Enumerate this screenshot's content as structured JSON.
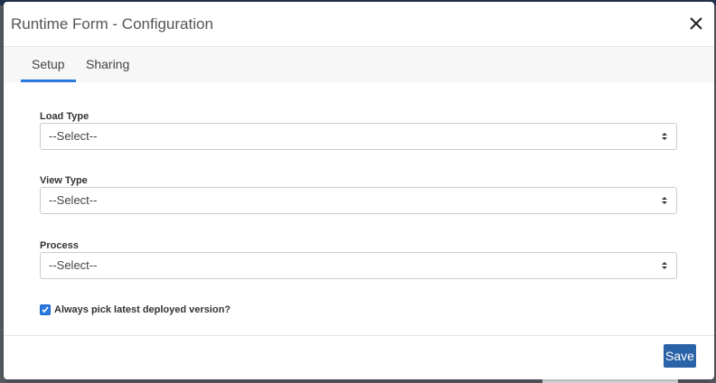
{
  "dialog": {
    "title": "Runtime Form - Configuration"
  },
  "tabs": [
    {
      "label": "Setup",
      "active": true
    },
    {
      "label": "Sharing",
      "active": false
    }
  ],
  "form": {
    "load_type": {
      "label": "Load Type",
      "value": "--Select--"
    },
    "view_type": {
      "label": "View Type",
      "value": "--Select--"
    },
    "process": {
      "label": "Process",
      "value": "--Select--"
    },
    "latest_version": {
      "label": "Always pick latest deployed version?",
      "checked": true
    }
  },
  "footer": {
    "save_label": "Save"
  },
  "colors": {
    "accent": "#2a7ae2",
    "save_button": "#2b63a8"
  }
}
